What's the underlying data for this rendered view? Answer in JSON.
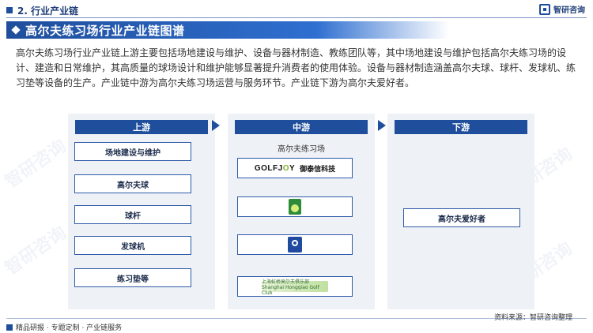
{
  "header": {
    "section_label": "2. 行业产业链",
    "brand_name": "智研咨询"
  },
  "title": "高尔夫练习场行业产业链图谱",
  "intro": "高尔夫练习场行业产业链上游主要包括场地建设与维护、设备与器材制造、教练团队等，其中场地建设与维护包括高尔夫练习场的设计、建造和日常维护，其高质量的球场设计和维护能够显著提升消费者的使用体验。设备与器材制造涵盖高尔夫球、球杆、发球机、练习垫等设备的生产。产业链中游为高尔夫练习场运营与服务环节。产业链下游为高尔夫爱好者。",
  "upstream": {
    "heading": "上游",
    "items": [
      "场地建设与维护",
      "高尔夫球",
      "球杆",
      "发球机",
      "练习垫等"
    ]
  },
  "midstream": {
    "heading": "中游",
    "subheading": "高尔夫练习场",
    "logos": [
      {
        "name": "golfjoy-logo",
        "text_a": "GOLFJ",
        "text_o": "O",
        "text_b": "Y",
        "text_cn": "御泰信科技"
      },
      {
        "name": "playgolf-logo"
      },
      {
        "name": "topgolf-logo"
      },
      {
        "name": "shanghai-golf-club-logo",
        "text": "上海虹桥高尔夫俱乐部 Shanghai Hongqiao Golf Club"
      }
    ]
  },
  "downstream": {
    "heading": "下游",
    "items": [
      "高尔夫爱好者"
    ]
  },
  "footer": {
    "left": "精品研报 · 专题定制 · 产业链服务",
    "source": "资料来源：智研咨询整理"
  },
  "colors": {
    "primary": "#1f4e9c",
    "panel_bg": "#eef1f6"
  }
}
